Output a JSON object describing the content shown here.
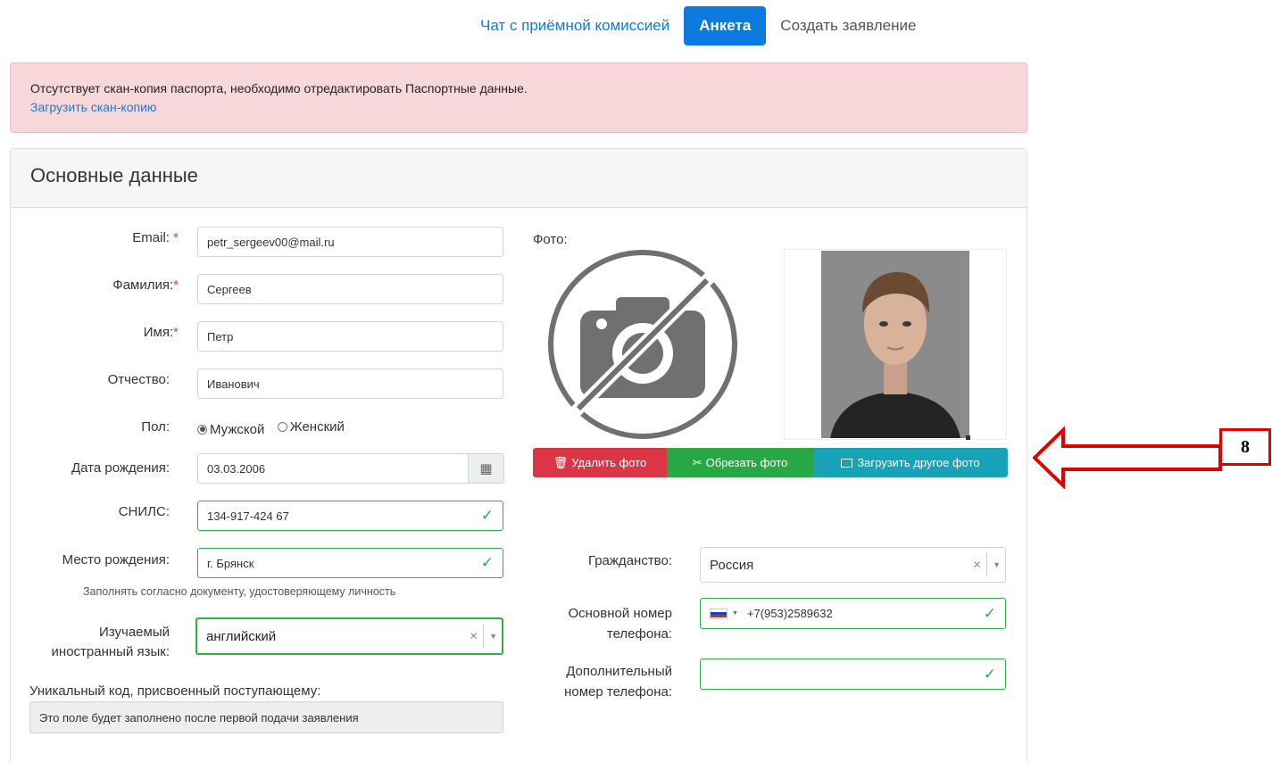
{
  "nav": {
    "chat": "Чат с приёмной комиссией",
    "anketa": "Анкета",
    "create": "Создать заявление"
  },
  "alert": {
    "message": "Отсутствует скан-копия паспорта, необходимо отредактировать Паспортные данные.",
    "link": "Загрузить скан-копию"
  },
  "card": {
    "title": "Основные данные"
  },
  "form": {
    "email": {
      "label": "Email:",
      "value": "petr_sergeev00@mail.ru"
    },
    "surname": {
      "label": "Фамилия:",
      "value": "Сергеев"
    },
    "name": {
      "label": "Имя:",
      "value": "Петр"
    },
    "patronymic": {
      "label": "Отчество:",
      "value": "Иванович"
    },
    "gender": {
      "label": "Пол:",
      "male": "Мужской",
      "female": "Женский",
      "selected": "male"
    },
    "birthdate": {
      "label": "Дата рождения:",
      "value": "03.03.2006"
    },
    "snils": {
      "label": "СНИЛС:",
      "value": "134-917-424 67"
    },
    "birthplace": {
      "label": "Место рождения:",
      "value": "г. Брянск",
      "hint": "Заполнять согласно документу, удостоверяющему личность"
    },
    "language": {
      "label_line1": "Изучаемый",
      "label_line2": "иностранный язык:",
      "value": "английский"
    },
    "unique_code": {
      "label": "Уникальный код, присвоенный поступающему:",
      "value": "Это поле будет заполнено после первой подачи заявления"
    },
    "photo": {
      "label": "Фото:"
    },
    "photo_buttons": {
      "delete": "Удалить фото",
      "crop": "Обрезать фото",
      "upload": "Загрузить другое фото"
    },
    "citizenship": {
      "label": "Гражданство:",
      "value": "Россия"
    },
    "phone_main": {
      "label_line1": "Основной номер",
      "label_line2": "телефона:",
      "value": "+7(953)2589632"
    },
    "phone_extra": {
      "label_line1": "Дополнительный",
      "label_line2": "номер телефона:",
      "value": ""
    }
  },
  "annotation": {
    "number": "8"
  },
  "colors": {
    "primary": "#0d7ae0",
    "danger": "#dc3545",
    "success": "#28a745",
    "info": "#17a2b8",
    "alert_bg": "#f8d7da",
    "annotation_red": "#e00000"
  }
}
